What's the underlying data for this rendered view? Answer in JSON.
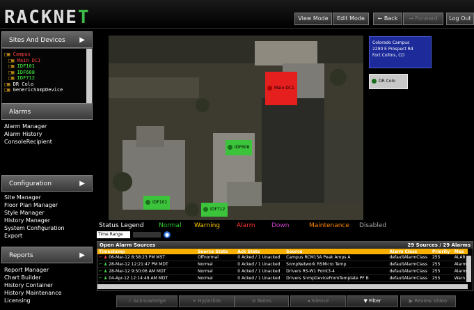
{
  "app": {
    "logo_a": "RACKNE",
    "logo_b": "T"
  },
  "topbar": {
    "view_mode": "View Mode",
    "edit_mode": "Edit Mode",
    "back": "← Back",
    "forward": "→ Forward",
    "logout": "Log Out"
  },
  "sidebar": {
    "sites_header": "Sites And Devices",
    "tree": [
      {
        "label": "Campus",
        "color": "#ff4040"
      },
      {
        "label": "Main DC1",
        "color": "#ff4040"
      },
      {
        "label": "IDF101",
        "color": "#44ff44"
      },
      {
        "label": "IDF608",
        "color": "#44ff44"
      },
      {
        "label": "IDF712",
        "color": "#44ff44"
      },
      {
        "label": "DR Colo",
        "color": "#ffffff"
      },
      {
        "label": "GenericSnmpDevice",
        "color": "#ffffff"
      }
    ],
    "alarms_header": "Alarms",
    "alarm_items": [
      "Alarm Manager",
      "Alarm History",
      "ConsoleRecipient"
    ],
    "config_header": "Configuration",
    "config_items": [
      "Site Manager",
      "Floor Plan Manager",
      "Style Manager",
      "History Manager",
      "System Configuration",
      "Export"
    ],
    "reports_header": "Reports",
    "report_items": [
      "Report Manager",
      "Chart Builder",
      "History Container",
      "History Maintenance",
      "Licensing"
    ]
  },
  "map": {
    "nodes": {
      "main_dc1": "Main DC1",
      "idf608": "IDF608",
      "idf101": "IDF101",
      "idf712": "IDF712",
      "dr_colo": "DR Colo"
    },
    "info": {
      "line1": "Colorado Campus",
      "line2": "2290 E Prospect Rd",
      "line3": "Fort Collins, CO"
    }
  },
  "legend": {
    "title": "Status Legend",
    "normal": "Normal",
    "warning": "Warning",
    "alarm": "Alarm",
    "down": "Down",
    "maintenance": "Maintenance",
    "disabled": "Disabled"
  },
  "time_range": {
    "label": "Time Range"
  },
  "alarms": {
    "title": "Open Alarm Sources",
    "count": "29 Sources / 29 Alarms",
    "columns": [
      "Timestamp",
      "Source State",
      "Ack State",
      "Source",
      "Alarm Class",
      "Priority",
      "Mes"
    ],
    "rows": [
      [
        "06-Mar-12 8:58:23 PM MST",
        "Offnormal",
        "0 Acked / 1 Unacked",
        "Campus RCM15A Peak Amps A",
        "defaultAlarmClass",
        "255",
        "ALAR"
      ],
      [
        "28-Mar-12 12:21:47 PM MDT",
        "Normal",
        "0 Acked / 1 Unacked",
        "SnmpNetwork RSMicro Temp",
        "defaultAlarmClass",
        "255",
        "Alarm"
      ],
      [
        "28-Mar-12 9:50:06 AM MDT",
        "Normal",
        "0 Acked / 1 Unacked",
        "Drivers RS-W1 Point3-4",
        "defaultAlarmClass",
        "255",
        "Alarm"
      ],
      [
        "04-Apr-12 12:14:49 AM MDT",
        "Normal",
        "0 Acked / 1 Unacked",
        "Drivers SnmpDeviceFromTemplate PF B",
        "defaultAlarmClass",
        "255",
        "Warn"
      ]
    ]
  },
  "actions": {
    "acknowledge": "Acknowledge",
    "hyperlink": "Hyperlink",
    "notes": "Notes",
    "silence": "Silence",
    "filter": "Filter",
    "review_video": "Review Video"
  }
}
